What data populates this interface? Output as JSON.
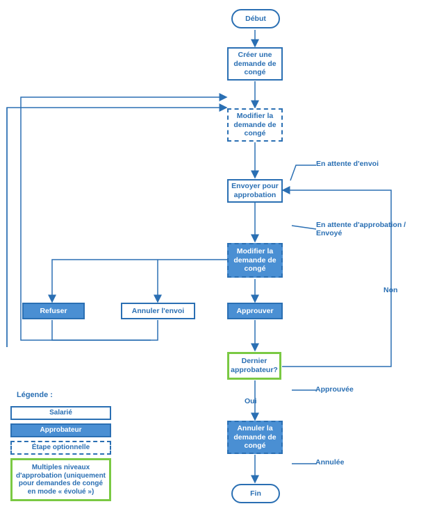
{
  "chart_data": {
    "type": "flowchart",
    "roles": {
      "employee": "Salarié",
      "approver": "Approbateur",
      "optional": "Étape optionnelle",
      "multi_level": "Multiples niveaux d'approbation (uniquement pour demandes de congé en mode « évolué »)"
    },
    "nodes": [
      {
        "id": "start",
        "type": "terminator",
        "label": "Début"
      },
      {
        "id": "create",
        "type": "process",
        "role": "employee",
        "label": "Créer une demande de congé"
      },
      {
        "id": "modify_emp",
        "type": "process",
        "role": "employee",
        "optional": true,
        "label": "Modifier la demande de congé"
      },
      {
        "id": "send",
        "type": "process",
        "role": "employee",
        "label": "Envoyer pour approbation"
      },
      {
        "id": "modify_appr",
        "type": "process",
        "role": "approver",
        "optional": true,
        "label": "Modifier la demande de congé"
      },
      {
        "id": "reject",
        "type": "process",
        "role": "approver",
        "label": "Refuser"
      },
      {
        "id": "cancel_send",
        "type": "process",
        "role": "employee",
        "label": "Annuler l'envoi"
      },
      {
        "id": "approve",
        "type": "process",
        "role": "approver",
        "label": "Approuver"
      },
      {
        "id": "last_approver",
        "type": "decision",
        "role": "multi_level",
        "label": "Dernier approbateur?"
      },
      {
        "id": "cancel_req",
        "type": "process",
        "role": "approver",
        "optional": true,
        "label": "Annuler la demande de congé"
      },
      {
        "id": "end",
        "type": "terminator",
        "label": "Fin"
      }
    ],
    "edges": [
      {
        "from": "start",
        "to": "create"
      },
      {
        "from": "create",
        "to": "modify_emp"
      },
      {
        "from": "modify_emp",
        "to": "send",
        "label": "En attente d'envoi"
      },
      {
        "from": "send",
        "to": "modify_appr",
        "label": "En attente d'approbation / Envoyé"
      },
      {
        "from": "modify_appr",
        "to": "reject"
      },
      {
        "from": "modify_appr",
        "to": "cancel_send"
      },
      {
        "from": "modify_appr",
        "to": "approve"
      },
      {
        "from": "approve",
        "to": "last_approver"
      },
      {
        "from": "last_approver",
        "to": "send",
        "label": "Non"
      },
      {
        "from": "last_approver",
        "to": "cancel_req",
        "label": "Oui",
        "state": "Approuvée"
      },
      {
        "from": "cancel_req",
        "to": "end",
        "label": "Annulée"
      },
      {
        "from": "reject",
        "to": "modify_emp"
      },
      {
        "from": "cancel_send",
        "to": "modify_emp"
      }
    ]
  },
  "nodes": {
    "start": "Début",
    "create": "Créer une demande de congé",
    "modify_emp": "Modifier la demande de congé",
    "send": "Envoyer pour approbation",
    "modify_appr": "Modifier la demande de congé",
    "reject": "Refuser",
    "cancel_send": "Annuler l'envoi",
    "approve": "Approuver",
    "last_approver": "Dernier approbateur?",
    "cancel_req": "Annuler la demande de congé",
    "end": "Fin"
  },
  "labels": {
    "await_send": "En attente d'envoi",
    "await_approval": "En attente d'approbation / Envoyé",
    "approved": "Approuvée",
    "yes": "Oui",
    "no": "Non",
    "cancelled": "Annulée"
  },
  "legend": {
    "title": "Légende :",
    "employee": "Salarié",
    "approver": "Approbateur",
    "optional": "Étape optionnelle",
    "multi": "Multiples niveaux d'approbation (uniquement pour demandes de congé en mode « évolué »)"
  }
}
